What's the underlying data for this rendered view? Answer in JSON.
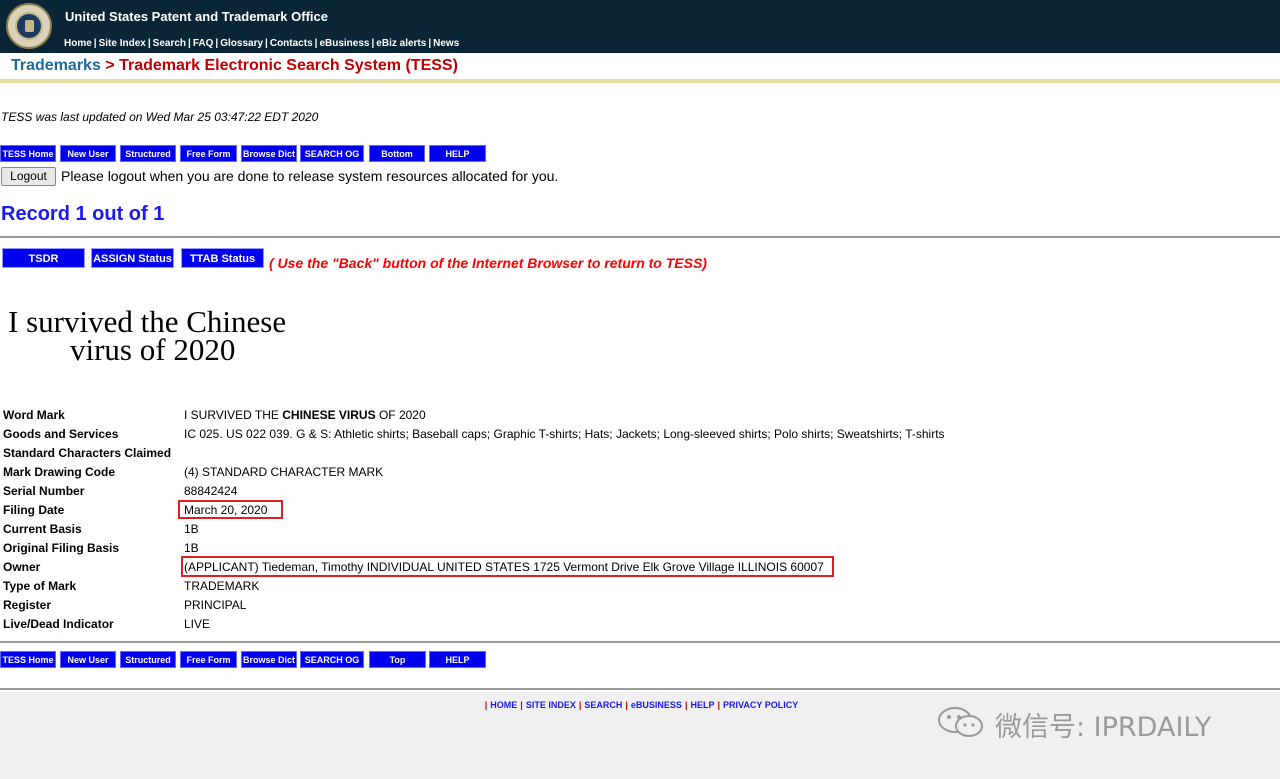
{
  "header": {
    "org_title": "United States Patent and Trademark Office",
    "nav": [
      "Home",
      "Site Index",
      "Search",
      "FAQ",
      "Glossary",
      "Contacts",
      "eBusiness",
      "eBiz alerts",
      "News"
    ]
  },
  "breadcrumb": {
    "trademarks": "Trademarks",
    "arrow": ">",
    "tess": "Trademark Electronic Search System (TESS)"
  },
  "updated_text": "TESS was last updated on Wed Mar 25 03:47:22 EDT 2020",
  "toolbar_top": [
    "TESS Home",
    "New User",
    "Structured",
    "Free Form",
    "Browse Dict",
    "SEARCH OG",
    "Bottom",
    "HELP"
  ],
  "toolbar_bottom": [
    "TESS Home",
    "New User",
    "Structured",
    "Free Form",
    "Browse Dict",
    "SEARCH OG",
    "Top",
    "HELP"
  ],
  "logout": {
    "label": "Logout",
    "message": "Please logout when you are done to release system resources allocated for you."
  },
  "record_text": "Record 1 out of 1",
  "status_buttons": {
    "tsdr": "TSDR",
    "assign": "ASSIGN Status",
    "ttab": "TTAB Status"
  },
  "back_message": "( Use the \"Back\" button of the Internet Browser to return to TESS)",
  "mark_image": {
    "line1": "I survived the Chinese",
    "line2": "virus of 2020"
  },
  "fields": [
    {
      "label": "Word Mark",
      "value": "I SURVIVED THE CHINESE VIRUS OF 2020"
    },
    {
      "label": "Goods and Services",
      "value": "IC 025. US 022 039. G & S: Athletic shirts; Baseball caps; Graphic T-shirts; Hats; Jackets; Long-sleeved shirts; Polo shirts; Sweatshirts; T-shirts"
    },
    {
      "label": "Standard Characters Claimed",
      "value": ""
    },
    {
      "label": "Mark Drawing Code",
      "value": "(4) STANDARD CHARACTER MARK"
    },
    {
      "label": "Serial Number",
      "value": "88842424"
    },
    {
      "label": "Filing Date",
      "value": "March 20, 2020"
    },
    {
      "label": "Current Basis",
      "value": "1B"
    },
    {
      "label": "Original Filing Basis",
      "value": "1B"
    },
    {
      "label": "Owner",
      "value": "(APPLICANT) Tiedeman, Timothy INDIVIDUAL UNITED STATES 1725 Vermont Drive Elk Grove Village ILLINOIS 60007"
    },
    {
      "label": "Type of Mark",
      "value": "TRADEMARK"
    },
    {
      "label": "Register",
      "value": "PRINCIPAL"
    },
    {
      "label": "Live/Dead Indicator",
      "value": "LIVE"
    }
  ],
  "footer_nav": [
    "HOME",
    "SITE INDEX",
    "SEARCH",
    "eBUSINESS",
    "HELP",
    "PRIVACY POLICY"
  ],
  "watermark": "微信号: IPRDAILY"
}
